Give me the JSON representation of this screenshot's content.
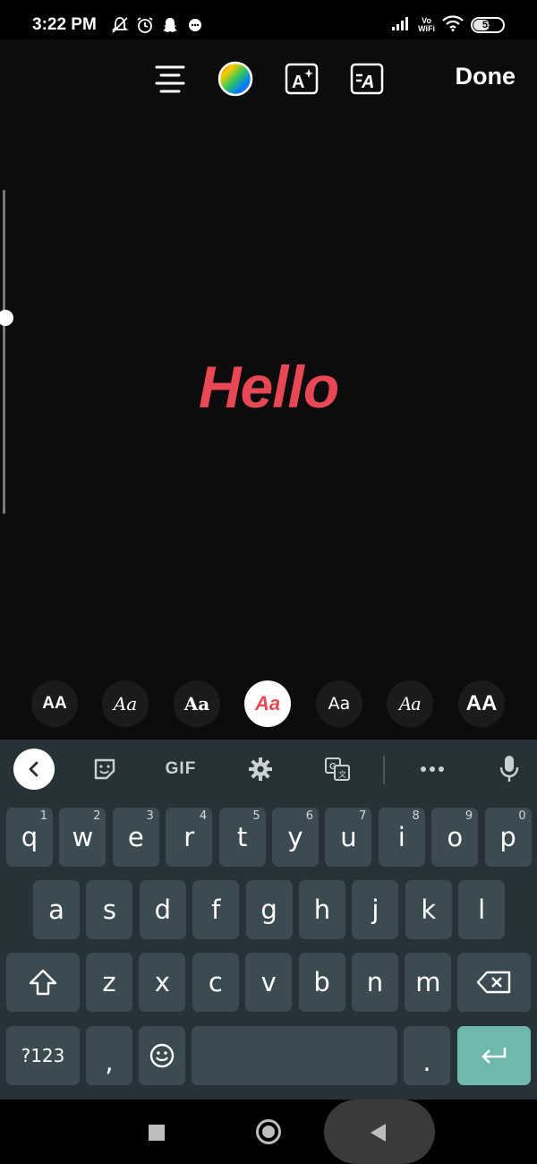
{
  "status_bar": {
    "time": "3:22 PM",
    "network_label_top": "Vo",
    "network_label_bottom": "WiFi",
    "battery_level": "55",
    "battery_fraction": 0.55,
    "left_icons": [
      "mute-icon",
      "alarm-icon",
      "snapchat-icon",
      "message-icon"
    ],
    "right_icons": [
      "signal-icon",
      "vowifi-icon",
      "wifi-icon",
      "battery-icon"
    ]
  },
  "toolbar": {
    "icons": [
      "align-center-icon",
      "color-wheel-icon",
      "text-effects-icon",
      "text-animation-icon"
    ],
    "done_label": "Done"
  },
  "editor": {
    "text": "Hello",
    "text_color": "#e84856",
    "size_slider_level": 0.4
  },
  "font_styles": {
    "options": [
      "AA",
      "Aa",
      "Aa",
      "Aa",
      "Aa",
      "Aa",
      "AA"
    ],
    "selected_index": 3,
    "selected_color": "#e84856"
  },
  "keyboard": {
    "tools": {
      "back": "chevron-left-icon",
      "sticker": "sticker-icon",
      "gif_label": "GIF",
      "settings": "gear-icon",
      "translate": "translate-icon",
      "more": "more-icon",
      "mic": "mic-icon"
    },
    "row1": [
      {
        "key": "q",
        "hint": "1"
      },
      {
        "key": "w",
        "hint": "2"
      },
      {
        "key": "e",
        "hint": "3"
      },
      {
        "key": "r",
        "hint": "4"
      },
      {
        "key": "t",
        "hint": "5"
      },
      {
        "key": "y",
        "hint": "6"
      },
      {
        "key": "u",
        "hint": "7"
      },
      {
        "key": "i",
        "hint": "8"
      },
      {
        "key": "o",
        "hint": "9"
      },
      {
        "key": "p",
        "hint": "0"
      }
    ],
    "row2": [
      "a",
      "s",
      "d",
      "f",
      "g",
      "h",
      "j",
      "k",
      "l"
    ],
    "row3": [
      "z",
      "x",
      "c",
      "v",
      "b",
      "n",
      "m"
    ],
    "symbols_label": "?123",
    "comma_label": ",",
    "period_label": "."
  },
  "colors": {
    "canvas_bg": "#0e0b0c",
    "keyboard_bg": "#263238",
    "key_bg": "#3c4a52",
    "enter_key_bg": "#6fb8ad",
    "accent_red": "#e84856"
  }
}
